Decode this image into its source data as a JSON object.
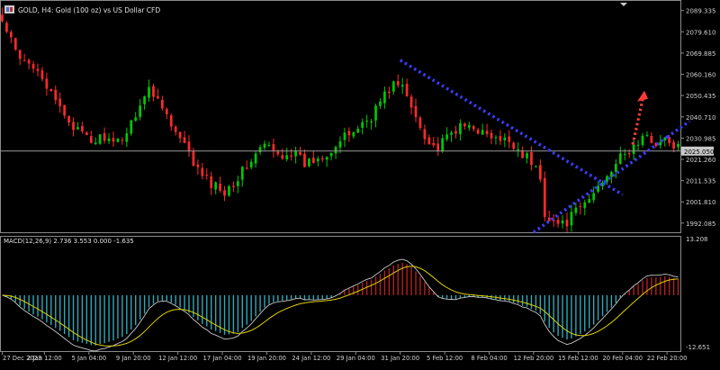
{
  "header": {
    "title": "GOLD, H4:  Gold (100 oz) vs US Dollar CFD",
    "icon": "window-icon"
  },
  "colors": {
    "background": "#000000",
    "bull_candle": "#00c800",
    "bear_candle": "#ff2a2a",
    "frame": "#8a8a8a",
    "price_line": "#9a9a9a",
    "trendline": "#3b3bff",
    "forecast_arrow": "#ff3b3b",
    "macd_positive": "#b52020",
    "macd_negative": "#30a8b8",
    "macd_line": "#c8c8c8",
    "signal_line": "#e0d000",
    "text": "#d0d0d0"
  },
  "price_axis": {
    "labels": [
      "2089.335",
      "2079.610",
      "2069.885",
      "2060.160",
      "2050.435",
      "2040.710",
      "2030.985",
      "2021.260",
      "2011.535",
      "2001.810",
      "1992.085"
    ],
    "current_price": "2025.050"
  },
  "macd_panel": {
    "title": "MACD(12,26,9) 2.736 3.553 0.000 -1.635",
    "axis_labels": [
      "13.208",
      "-12.651"
    ]
  },
  "time_axis": {
    "labels": [
      "27 Dec 2023",
      "2 Jan 12:00",
      "5 Jan 04:00",
      "9 Jan 20:00",
      "12 Jan 12:00",
      "17 Jan 04:00",
      "19 Jan 20:00",
      "24 Jan 12:00",
      "29 Jan 04:00",
      "31 Jan 20:00",
      "5 Feb 12:00",
      "8 Feb 04:00",
      "12 Feb 20:00",
      "15 Feb 12:00",
      "20 Feb 04:00",
      "22 Feb 20:00"
    ]
  },
  "chart_data": {
    "type": "candlestick",
    "symbol": "GOLD",
    "timeframe": "H4",
    "ylim": [
      1987.5,
      2092.5
    ],
    "current_price": 2025.05,
    "close_path": [
      [
        0,
        2084
      ],
      [
        4,
        2066
      ],
      [
        8,
        2064
      ],
      [
        11,
        2050
      ],
      [
        14,
        2042
      ],
      [
        17,
        2034
      ],
      [
        20,
        2029
      ],
      [
        23,
        2032
      ],
      [
        25,
        2027
      ],
      [
        28,
        2034
      ],
      [
        31,
        2047
      ],
      [
        33,
        2053
      ],
      [
        36,
        2047
      ],
      [
        38,
        2036
      ],
      [
        41,
        2027
      ],
      [
        44,
        2016
      ],
      [
        47,
        2010
      ],
      [
        50,
        2007
      ],
      [
        53,
        2013
      ],
      [
        56,
        2021
      ],
      [
        59,
        2028
      ],
      [
        62,
        2023
      ],
      [
        65,
        2025
      ],
      [
        68,
        2019
      ],
      [
        71,
        2022
      ],
      [
        74,
        2026
      ],
      [
        77,
        2031
      ],
      [
        80,
        2036
      ],
      [
        83,
        2041
      ],
      [
        85,
        2048
      ],
      [
        88,
        2056
      ],
      [
        90,
        2054
      ],
      [
        92,
        2045
      ],
      [
        94,
        2037
      ],
      [
        96,
        2029
      ],
      [
        98,
        2026
      ],
      [
        100,
        2031
      ],
      [
        102,
        2035
      ],
      [
        104,
        2036
      ],
      [
        106,
        2037
      ],
      [
        108,
        2033
      ],
      [
        110,
        2031
      ],
      [
        112,
        2029
      ],
      [
        114,
        2030
      ],
      [
        116,
        2026
      ],
      [
        118,
        2022
      ],
      [
        120,
        2017
      ],
      [
        121,
        2012
      ],
      [
        122,
        1997
      ],
      [
        124,
        1993
      ],
      [
        126,
        1991
      ],
      [
        128,
        1995
      ],
      [
        130,
        1999
      ],
      [
        132,
        2003
      ],
      [
        134,
        2009
      ],
      [
        136,
        2015
      ],
      [
        138,
        2020
      ],
      [
        140,
        2023
      ],
      [
        142,
        2027
      ],
      [
        144,
        2031
      ],
      [
        146,
        2030
      ],
      [
        148,
        2029
      ],
      [
        149,
        2030
      ],
      [
        150,
        2028
      ],
      [
        152,
        2027
      ]
    ],
    "trendlines": [
      {
        "name": "descending-resistance",
        "from": {
          "x": "31 Jan 20:00",
          "y": 2066.6
        },
        "to": {
          "x": "20 Feb 04:00",
          "y": 2005.1
        }
      },
      {
        "name": "ascending-support",
        "from": {
          "x": "12 Feb 20:00",
          "y": 1987.9
        },
        "to": {
          "x": "22 Feb 20:00",
          "y": 2031.4
        }
      }
    ],
    "forecast_arrow": {
      "from": 2028,
      "to": 2051,
      "direction": "up"
    },
    "macd": {
      "params": [
        12,
        26,
        9
      ],
      "values": [
        2.736,
        3.553,
        0.0,
        -1.635
      ],
      "ylim": [
        -12.651,
        13.208
      ]
    }
  }
}
